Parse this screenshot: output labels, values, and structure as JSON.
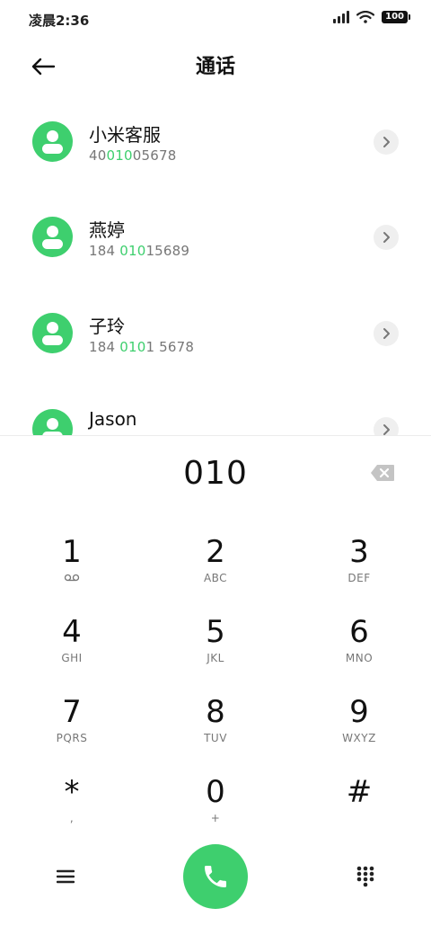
{
  "status": {
    "time": "凌晨2:36",
    "battery": "100"
  },
  "header": {
    "title": "通话"
  },
  "contacts": [
    {
      "name": "小米客服",
      "number_pre": "40",
      "number_hl": "010",
      "number_post": "05678"
    },
    {
      "name": "燕婷",
      "number_pre": "184 ",
      "number_hl": "010",
      "number_post": "15689"
    },
    {
      "name": "子玲",
      "number_pre": "184 ",
      "number_hl": "010",
      "number_post": "1 5678"
    },
    {
      "name": "Jason",
      "number_pre": "",
      "number_hl": "",
      "number_post": ""
    }
  ],
  "dial": {
    "digits": "010"
  },
  "keys": [
    {
      "digit": "1",
      "letters": ""
    },
    {
      "digit": "2",
      "letters": "ABC"
    },
    {
      "digit": "3",
      "letters": "DEF"
    },
    {
      "digit": "4",
      "letters": "GHI"
    },
    {
      "digit": "5",
      "letters": "JKL"
    },
    {
      "digit": "6",
      "letters": "MNO"
    },
    {
      "digit": "7",
      "letters": "PQRS"
    },
    {
      "digit": "8",
      "letters": "TUV"
    },
    {
      "digit": "9",
      "letters": "WXYZ"
    },
    {
      "digit": "*",
      "letters": ","
    },
    {
      "digit": "0",
      "letters": "+"
    },
    {
      "digit": "#",
      "letters": ""
    }
  ],
  "colors": {
    "accent": "#3ecf6e",
    "text": "#111111",
    "subtext": "#777777"
  },
  "icons": {
    "back": "arrow-left-icon",
    "chevron": "chevron-right-icon",
    "backspace": "backspace-icon",
    "voicemail": "voicemail-icon",
    "menu": "menu-icon",
    "call": "phone-icon",
    "dialpad": "dialpad-icon"
  }
}
